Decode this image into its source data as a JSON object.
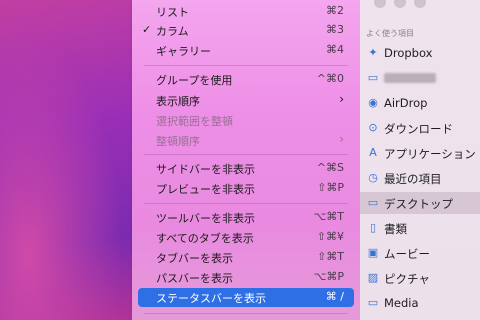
{
  "menu": {
    "items": [
      {
        "label": "リスト",
        "shortcut": "⌘2",
        "checked": false
      },
      {
        "label": "カラム",
        "shortcut": "⌘3",
        "checked": true
      },
      {
        "label": "ギャラリー",
        "shortcut": "⌘4",
        "checked": false
      },
      {
        "label": "グループを使用",
        "shortcut": "^⌘0"
      },
      {
        "label": "表示順序",
        "submenu": true
      },
      {
        "label": "選択範囲を整頓",
        "disabled": true
      },
      {
        "label": "整頓順序",
        "disabled": true,
        "submenu": true
      },
      {
        "label": "サイドバーを非表示",
        "shortcut": "^⌘S"
      },
      {
        "label": "プレビューを非表示",
        "shortcut": "⇧⌘P"
      },
      {
        "label": "ツールバーを非表示",
        "shortcut": "⌥⌘T"
      },
      {
        "label": "すべてのタブを表示",
        "shortcut": "⇧⌘¥"
      },
      {
        "label": "タブバーを表示",
        "shortcut": "⇧⌘T"
      },
      {
        "label": "パスバーを表示",
        "shortcut": "⌥⌘P"
      },
      {
        "label": "ステータスバーを表示",
        "shortcut": "⌘ /",
        "selected": true
      }
    ],
    "check_glyph": "✓",
    "arrow_glyph": "›"
  },
  "sidebar": {
    "section_title": "よく使う項目",
    "items": [
      {
        "label": "Dropbox",
        "icon": "dropbox-icon",
        "glyph": "✦"
      },
      {
        "label": "",
        "icon": "folder-icon",
        "glyph": "▭",
        "redacted": true
      },
      {
        "label": "AirDrop",
        "icon": "airdrop-icon",
        "glyph": "◉"
      },
      {
        "label": "ダウンロード",
        "icon": "download-icon",
        "glyph": "⊙"
      },
      {
        "label": "アプリケーション",
        "icon": "applications-icon",
        "glyph": "A"
      },
      {
        "label": "最近の項目",
        "icon": "clock-icon",
        "glyph": "◷"
      },
      {
        "label": "デスクトップ",
        "icon": "desktop-icon",
        "glyph": "▭",
        "active": true
      },
      {
        "label": "書類",
        "icon": "document-icon",
        "glyph": "▯"
      },
      {
        "label": "ムービー",
        "icon": "movie-icon",
        "glyph": "▣"
      },
      {
        "label": "ピクチャ",
        "icon": "picture-icon",
        "glyph": "▨"
      },
      {
        "label": "Media",
        "icon": "folder-icon",
        "glyph": "▭"
      }
    ]
  },
  "colors": {
    "selection": "#2f6fe6",
    "accent": "#3772d6"
  }
}
